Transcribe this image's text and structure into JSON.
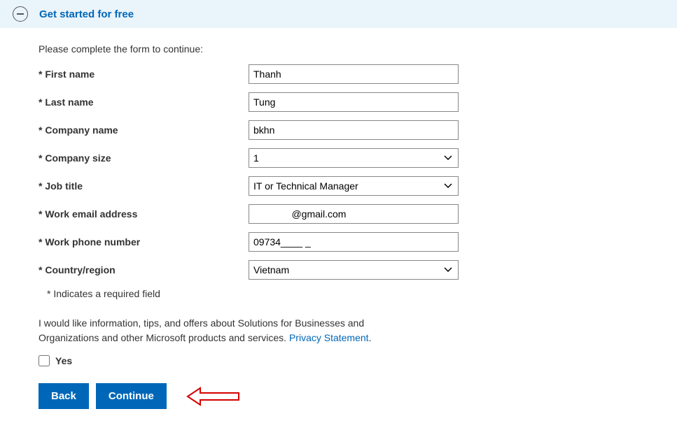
{
  "header": {
    "title": "Get started for free"
  },
  "intro": "Please complete the form to continue:",
  "fields": {
    "first_name": {
      "label": "* First name",
      "value": "Thanh"
    },
    "last_name": {
      "label": "* Last name",
      "value": "Tung"
    },
    "company_name": {
      "label": "* Company name",
      "value": "bkhn"
    },
    "company_size": {
      "label": "* Company size",
      "value": "1"
    },
    "job_title": {
      "label": "* Job title",
      "value": "IT or Technical Manager"
    },
    "work_email": {
      "label": "* Work email address",
      "value": "              @gmail.com"
    },
    "work_phone": {
      "label": "* Work phone number",
      "value": "09734____ _"
    },
    "country": {
      "label": "* Country/region",
      "value": "Vietnam"
    }
  },
  "required_note": "* Indicates a required field",
  "consent_text": "I would like information, tips, and offers about Solutions for Businesses and Organizations and other Microsoft products and services. ",
  "privacy_link": "Privacy Statement",
  "checkbox_label": "Yes",
  "buttons": {
    "back": "Back",
    "continue": "Continue"
  }
}
